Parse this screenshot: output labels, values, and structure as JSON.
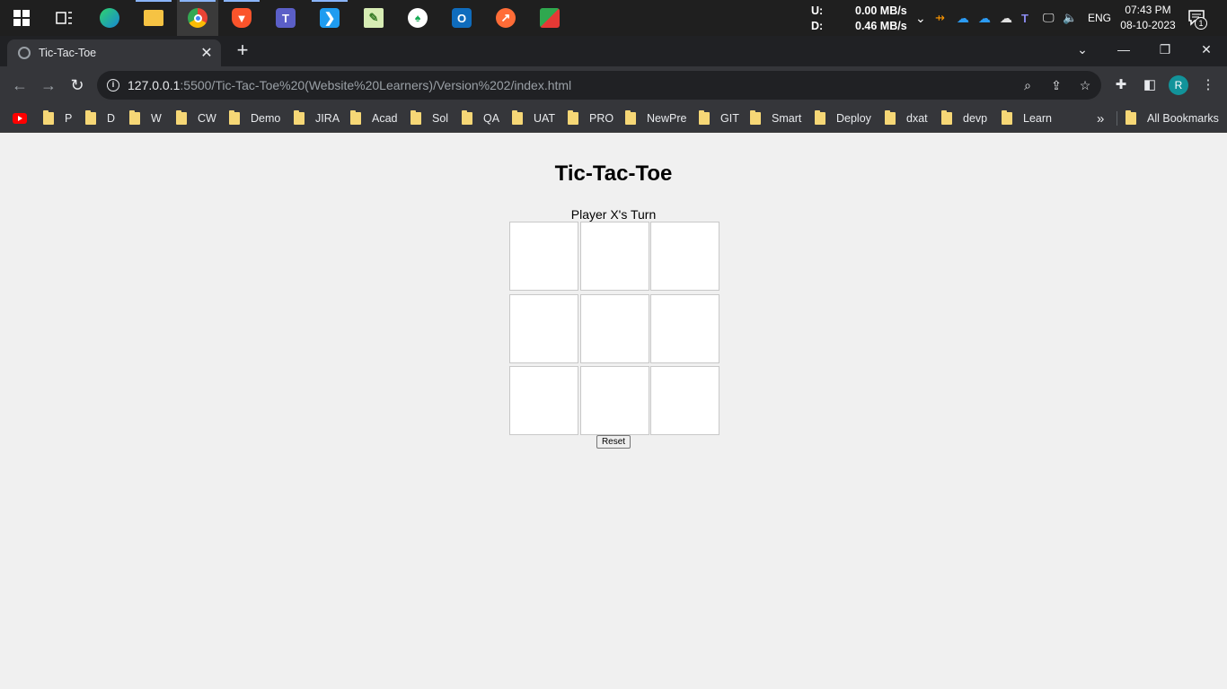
{
  "taskbar": {
    "apps": [
      {
        "name": "start-menu-icon"
      },
      {
        "name": "task-view-icon"
      },
      {
        "name": "edge-icon"
      },
      {
        "name": "file-explorer-icon"
      },
      {
        "name": "chrome-icon"
      },
      {
        "name": "brave-icon"
      },
      {
        "name": "teams-icon"
      },
      {
        "name": "vscode-icon"
      },
      {
        "name": "notepad-plus-plus-icon"
      },
      {
        "name": "mongodb-compass-icon"
      },
      {
        "name": "outlook-icon"
      },
      {
        "name": "postman-icon"
      },
      {
        "name": "app-icon"
      }
    ],
    "network": {
      "up_label": "U:",
      "up_value": "0.00 MB/s",
      "down_label": "D:",
      "down_value": "0.46 MB/s"
    },
    "language": "ENG",
    "time": "07:43 PM",
    "date": "08-10-2023",
    "notification_count": "1"
  },
  "browser": {
    "tab_title": "Tic-Tac-Toe",
    "url_host": "127.0.0.1",
    "url_rest": ":5500/Tic-Tac-Toe%20(Website%20Learners)/Version%202/index.html",
    "profile_initial": "R",
    "bookmarks": [
      "P",
      "D",
      "W",
      "CW",
      "Demo",
      "JIRA",
      "Acad",
      "Sol",
      "QA",
      "UAT",
      "PRO",
      "NewPre",
      "GIT",
      "Smart",
      "Deploy",
      "dxat",
      "devp",
      "Learn"
    ],
    "bookmarks_overflow": "»",
    "all_bookmarks": "All Bookmarks"
  },
  "game": {
    "title": "Tic-Tac-Toe",
    "status": "Player X's Turn",
    "cells": [
      "",
      "",
      "",
      "",
      "",
      "",
      "",
      "",
      ""
    ],
    "reset_label": "Reset"
  },
  "colors": {
    "taskbar_bg": "#1f1f1f",
    "chrome_dark": "#202124",
    "chrome_toolbar": "#35363a",
    "page_bg": "#f0f0f0",
    "profile_accent": "#12939a"
  }
}
